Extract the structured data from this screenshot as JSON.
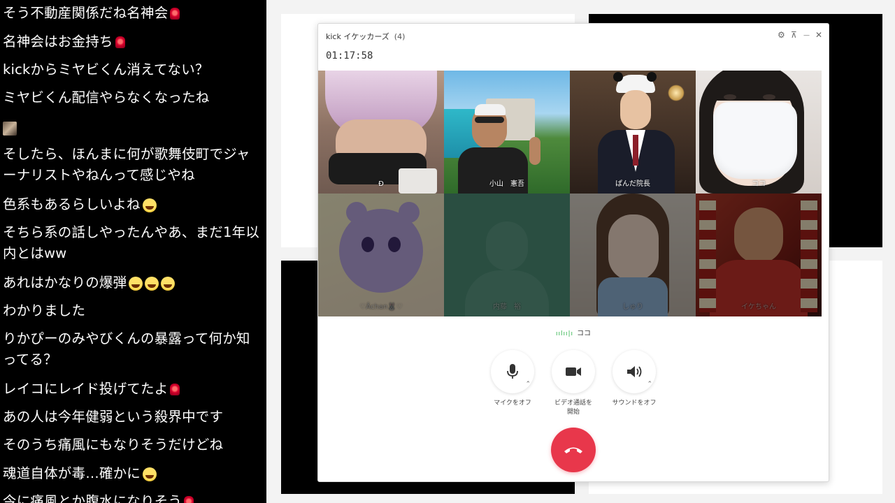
{
  "chat": {
    "messages": [
      {
        "text": "そう不動産関係だね名神会",
        "emoji": "red"
      },
      {
        "text": "名神会はお金持ち",
        "emoji": "red"
      },
      {
        "text": "kickからミヤビくん消えてない？",
        "emoji": ""
      },
      {
        "text": "ミヤビくん配信やらなくなったね",
        "emoji": ""
      },
      {
        "text": "そしたら、ほんまに何が歌舞伎町でジャーナリストやねんって感じやね",
        "emoji": ""
      },
      {
        "text": "色系もあるらしいよね",
        "emoji": "laugh"
      },
      {
        "text": "そちら系の話しやったんやあ、まだ1年以内とはww",
        "emoji": ""
      },
      {
        "text": "あれはかなりの爆弾",
        "emoji": "laugh3"
      },
      {
        "text": "わかりました",
        "emoji": ""
      },
      {
        "text": "りかぴーのみやびくんの暴露って何か知ってる？",
        "emoji": ""
      },
      {
        "text": "レイコにレイド投げてたよ",
        "emoji": "red"
      },
      {
        "text": "あの人は今年健弱という殺界中です",
        "emoji": ""
      },
      {
        "text": "そのうち痛風にもなりそうだけどね",
        "emoji": ""
      },
      {
        "text": "魂道自体が毒…確かに",
        "emoji": "laugh"
      },
      {
        "text": "今に痛風とか腹水になりそう",
        "emoji": "red"
      }
    ]
  },
  "call": {
    "title": "kick イケッカーズ",
    "member_count": "(4)",
    "timer": "01:17:58",
    "controls": {
      "settings": "⚙",
      "pin": "⊼",
      "minimize": "—",
      "close": "✕"
    },
    "participants": [
      {
        "name": "Ð",
        "active": true
      },
      {
        "name": "小山　憲吾",
        "active": true
      },
      {
        "name": "ぱんだ院長",
        "active": true
      },
      {
        "name": "ココ",
        "active": true
      },
      {
        "name": "♡Åchan🐰♡",
        "active": false
      },
      {
        "name": "内藤　裕",
        "active": false
      },
      {
        "name": "しゅり",
        "active": false
      },
      {
        "name": "イケちゃん",
        "active": false
      }
    ],
    "speaking": "ココ",
    "buttons": {
      "mic": "マイクをオフ",
      "video": "ビデオ通話を\n開始",
      "sound": "サウンドをオフ"
    },
    "accent": "#e8374b"
  }
}
